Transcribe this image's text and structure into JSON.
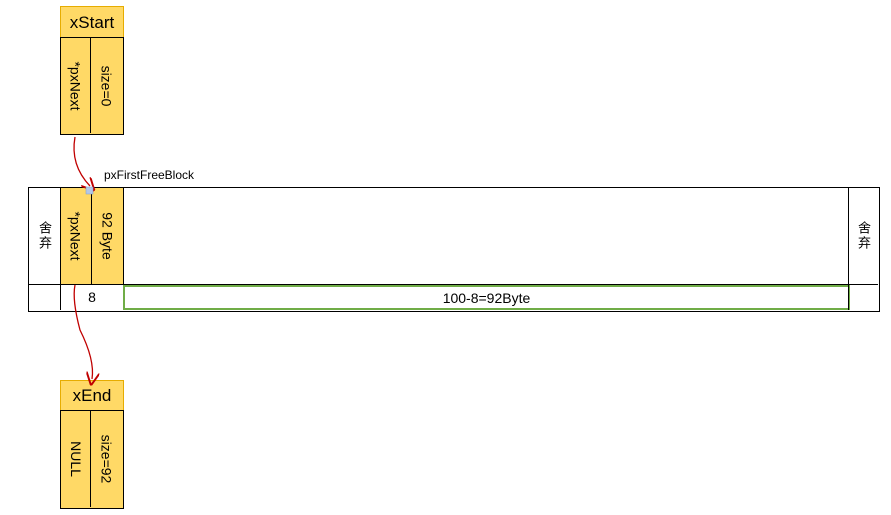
{
  "start_node": {
    "title": "xStart",
    "field_next": "*pxNext",
    "field_size": "size=0"
  },
  "pointer_label": "pxFirstFreeBlock",
  "heap": {
    "discard_left": "舍弃",
    "discard_right": "舍弃",
    "block_next": "*pxNext",
    "block_size": "92 Byte",
    "header_size": "8",
    "free_size": "100-8=92Byte"
  },
  "end_node": {
    "title": "xEnd",
    "field_next": "NULL",
    "field_size": "size=92"
  },
  "colors": {
    "node_fill": "#ffd966",
    "free_outline": "#70ad47",
    "arrow": "#c00000",
    "pointer_marker": "#b4c7e7"
  }
}
